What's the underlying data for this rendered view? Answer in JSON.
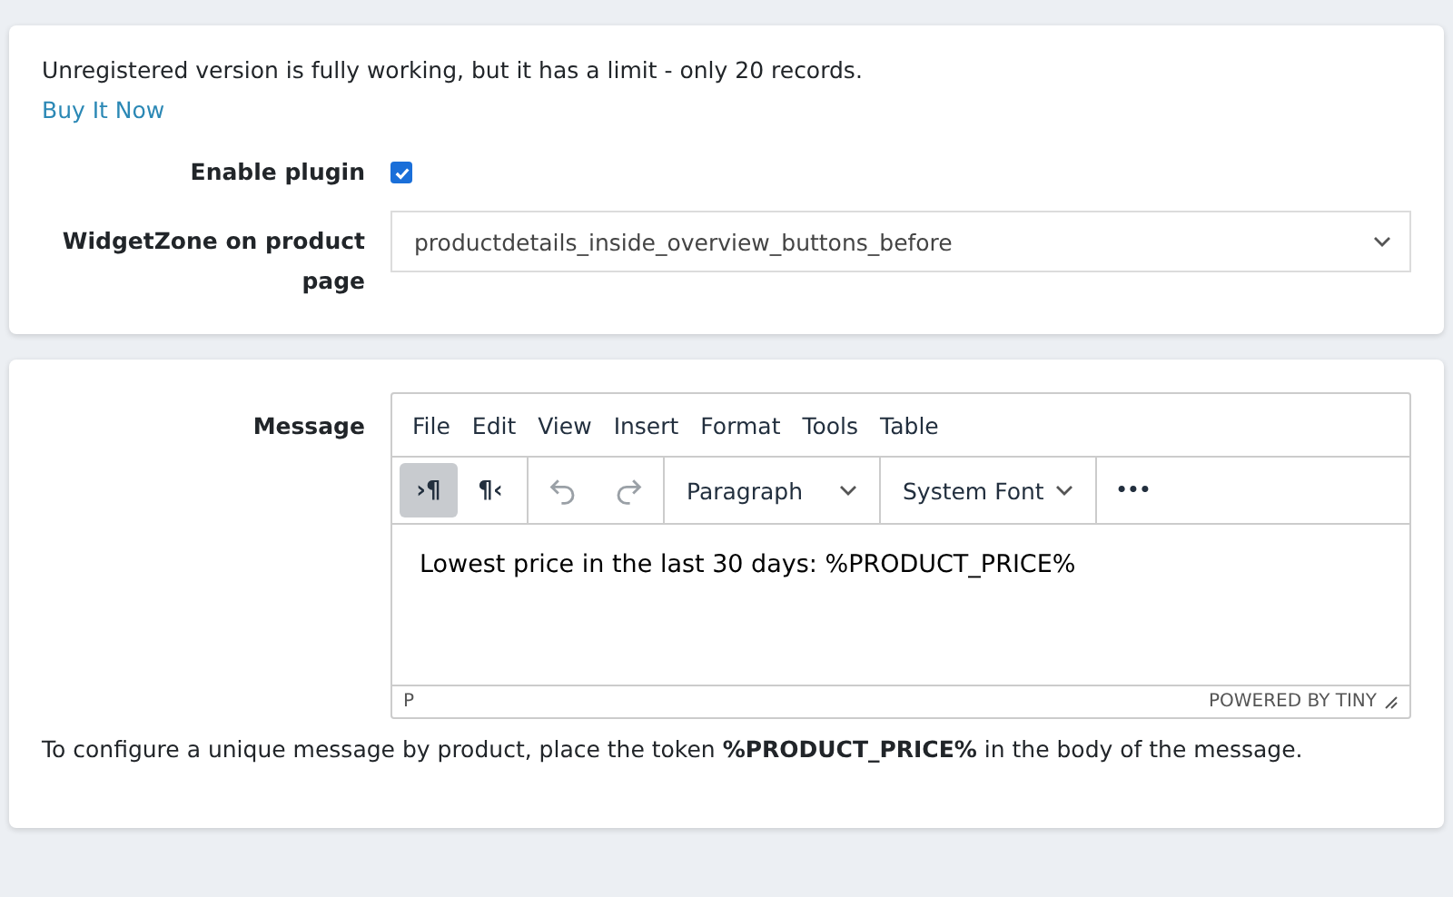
{
  "license_panel": {
    "notice": "Unregistered version is fully working, but it has a limit - only 20 records.",
    "link": "Buy It Now",
    "fields": [
      {
        "kind": "checkbox",
        "label": "Enable plugin",
        "checked": true
      },
      {
        "kind": "select",
        "label": "WidgetZone on product page",
        "value": "productdetails_inside_overview_buttons_before"
      }
    ]
  },
  "message_panel": {
    "label": "Message",
    "editor": {
      "menu": [
        "File",
        "Edit",
        "View",
        "Insert",
        "Format",
        "Tools",
        "Table"
      ],
      "toolbar": [
        {
          "kind": "toggle",
          "glyph": "›¶",
          "selected": true
        },
        {
          "kind": "toggle",
          "glyph": "¶‹",
          "selected": false
        },
        {
          "kind": "undo",
          "disabled": true
        },
        {
          "kind": "redo",
          "disabled": true
        },
        {
          "kind": "dropdown",
          "value": "Paragraph"
        },
        {
          "kind": "dropdown",
          "value": "System Font"
        },
        {
          "kind": "more",
          "glyph": "•••"
        }
      ],
      "content": "Lowest price in the last 30 days: %PRODUCT_PRICE%",
      "path": "P",
      "branding": "POWERED BY TINY"
    },
    "hint": "To configure a unique message by product, place the token **%PRODUCT_PRICE%** in the body of the message."
  }
}
